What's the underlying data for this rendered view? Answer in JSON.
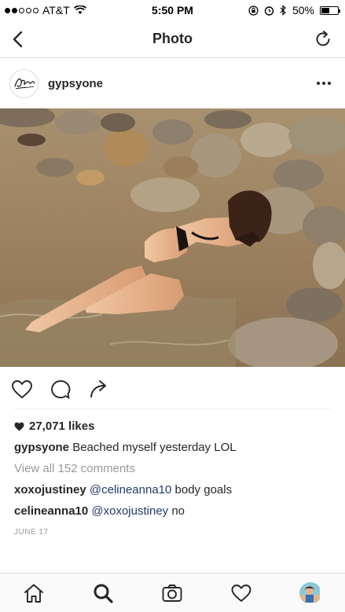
{
  "status_bar": {
    "carrier": "AT&T",
    "time": "5:50 PM",
    "battery": "50%",
    "battery_level": 0.5,
    "signal_bars_filled": 2,
    "signal_bars_total": 5
  },
  "nav": {
    "title": "Photo"
  },
  "post": {
    "username": "gypsyone",
    "likes": "27,071 likes",
    "caption_user": "gypsyone",
    "caption_text": "Beached myself yesterday LOL",
    "view_all": "View all 152 comments",
    "comments": [
      {
        "user": "xoxojustiney",
        "mention": "@celineanna10",
        "text": "body goals"
      },
      {
        "user": "celineanna10",
        "mention": "@xoxojustiney",
        "text": "no"
      }
    ],
    "date": "JUNE 17"
  },
  "icons": {
    "back": "chevron-left-icon",
    "refresh": "refresh-icon",
    "more": "more-icon",
    "like": "heart-icon",
    "comment": "comment-icon",
    "share": "share-icon",
    "home": "home-icon",
    "search": "search-icon",
    "camera": "camera-icon",
    "activity": "heart-icon",
    "profile": "profile-icon"
  },
  "colors": {
    "mention": "#1f3a6e",
    "muted": "#999999",
    "text": "#262626"
  }
}
